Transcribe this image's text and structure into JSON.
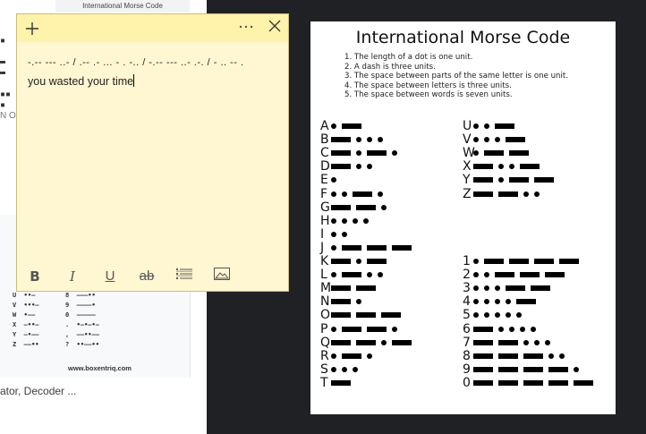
{
  "left_panel": {
    "thumb_title": "International Morse Code",
    "thumb_url": "www.boxentriq.com",
    "caption": "ator, Decoder ...",
    "thumb_rows": [
      "U  ••—        8  ———••",
      "V  •••—       9  ————•",
      "W  •——        0  —————",
      "X  —••—       .  •—•—•—",
      "Y  —•——       ,  ——••——",
      "Z  ——••       ?  ••——••"
    ],
    "fragment": "N OU"
  },
  "sticky_note": {
    "morse_text": "-.-- --- ..- / .-- .- ... - . -.. / -.-- --- ..- .-. / - .. -- .",
    "plain_text": "you wasted your time",
    "toolbar": {
      "bold": "B",
      "italic": "I",
      "underline": "U",
      "strikethrough": "ab"
    }
  },
  "morse_chart": {
    "title": "International Morse Code",
    "rules": [
      "1. The length of a dot is one unit.",
      "2. A dash is three units.",
      "3. The space between parts of the same letter is one unit.",
      "4. The space between letters is three units.",
      "5. The space between words is seven units."
    ],
    "left_column": [
      {
        "char": "A",
        "code": ".-"
      },
      {
        "char": "B",
        "code": "-..."
      },
      {
        "char": "C",
        "code": "-.-."
      },
      {
        "char": "D",
        "code": "-.."
      },
      {
        "char": "E",
        "code": "."
      },
      {
        "char": "F",
        "code": "..-."
      },
      {
        "char": "G",
        "code": "--."
      },
      {
        "char": "H",
        "code": "...."
      },
      {
        "char": "I",
        "code": ".."
      },
      {
        "char": "J",
        "code": ".---"
      },
      {
        "char": "K",
        "code": "-.-"
      },
      {
        "char": "L",
        "code": ".-.."
      },
      {
        "char": "M",
        "code": "--"
      },
      {
        "char": "N",
        "code": "-."
      },
      {
        "char": "O",
        "code": "---"
      },
      {
        "char": "P",
        "code": ".--."
      },
      {
        "char": "Q",
        "code": "--.-"
      },
      {
        "char": "R",
        "code": ".-."
      },
      {
        "char": "S",
        "code": "..."
      },
      {
        "char": "T",
        "code": "-"
      }
    ],
    "right_letters": [
      {
        "char": "U",
        "code": "..-"
      },
      {
        "char": "V",
        "code": "...-"
      },
      {
        "char": "W",
        "code": ".--"
      },
      {
        "char": "X",
        "code": "-..-"
      },
      {
        "char": "Y",
        "code": "-.--"
      },
      {
        "char": "Z",
        "code": "--.."
      }
    ],
    "right_numbers": [
      {
        "char": "1",
        "code": ".----"
      },
      {
        "char": "2",
        "code": "..---"
      },
      {
        "char": "3",
        "code": "...--"
      },
      {
        "char": "4",
        "code": "....-"
      },
      {
        "char": "5",
        "code": "....."
      },
      {
        "char": "6",
        "code": "-...."
      },
      {
        "char": "7",
        "code": "--..."
      },
      {
        "char": "8",
        "code": "---.."
      },
      {
        "char": "9",
        "code": "----."
      },
      {
        "char": "0",
        "code": "-----"
      }
    ]
  }
}
